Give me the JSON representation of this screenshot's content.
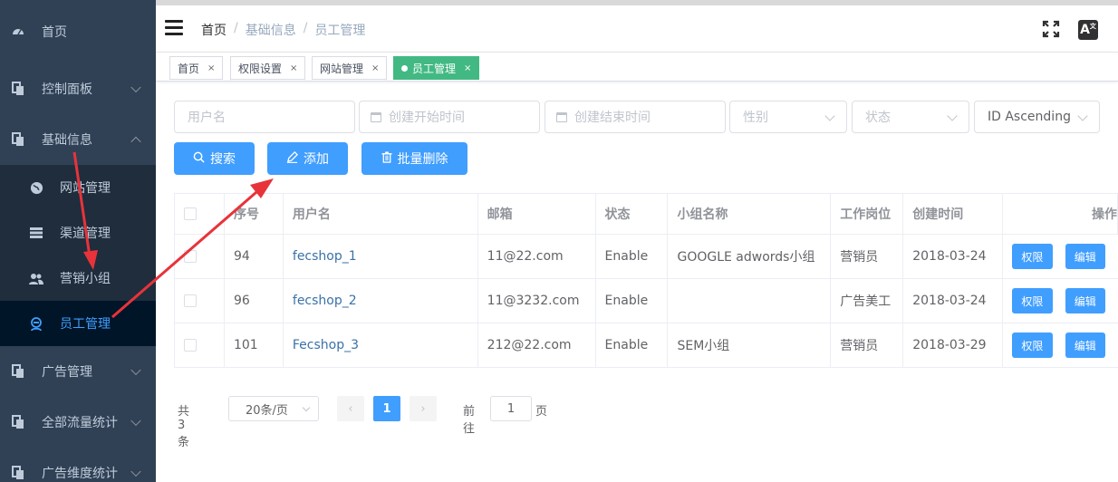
{
  "sidebar": {
    "items": [
      {
        "label": "首页",
        "icon": "dashboard-icon"
      },
      {
        "label": "控制面板",
        "icon": "copy-icon",
        "expanded": false
      },
      {
        "label": "基础信息",
        "icon": "copy-icon",
        "expanded": true
      },
      {
        "label": "广告管理",
        "icon": "copy-icon",
        "expanded": false
      },
      {
        "label": "全部流量统计",
        "icon": "copy-icon",
        "expanded": false
      },
      {
        "label": "广告维度统计",
        "icon": "copy-icon",
        "expanded": false
      }
    ],
    "submenu": [
      {
        "label": "网站管理",
        "icon": "globe-icon"
      },
      {
        "label": "渠道管理",
        "icon": "table-icon"
      },
      {
        "label": "营销小组",
        "icon": "users-icon"
      },
      {
        "label": "员工管理",
        "icon": "user-icon",
        "active": true
      }
    ]
  },
  "navbar": {
    "breadcrumb": [
      "首页",
      "基础信息",
      "员工管理"
    ],
    "separator": "/",
    "lang_label": "A",
    "lang_sup": "文"
  },
  "tags": [
    {
      "label": "首页"
    },
    {
      "label": "权限设置"
    },
    {
      "label": "网站管理"
    },
    {
      "label": "员工管理",
      "active": true
    }
  ],
  "tag_close": "×",
  "filters": {
    "username_placeholder": "用户名",
    "start_time_placeholder": "创建开始时间",
    "end_time_placeholder": "创建结束时间",
    "gender_placeholder": "性别",
    "status_placeholder": "状态",
    "sort_value": "ID Ascending"
  },
  "actions": {
    "search_label": "搜索",
    "add_label": "添加",
    "batch_delete_label": "批量删除"
  },
  "table": {
    "columns": [
      "序号",
      "用户名",
      "邮箱",
      "状态",
      "小组名称",
      "工作岗位",
      "创建时间",
      "操作"
    ],
    "rows": [
      {
        "id": "94",
        "username": "fecshop_1",
        "email": "11@22.com",
        "status": "Enable",
        "group": "GOOGLE adwords小组",
        "position": "营销员",
        "created": "2018-03-24"
      },
      {
        "id": "96",
        "username": "fecshop_2",
        "email": "11@3232.com",
        "status": "Enable",
        "group": "",
        "position": "广告美工",
        "created": "2018-03-24"
      },
      {
        "id": "101",
        "username": "Fecshop_3",
        "email": "212@22.com",
        "status": "Enable",
        "group": "SEM小组",
        "position": "营销员",
        "created": "2018-03-29"
      }
    ],
    "permission_label": "权限",
    "edit_label": "编辑"
  },
  "pagination": {
    "total": "共 3 条",
    "page_size": "20条/页",
    "prev": "‹",
    "next": "›",
    "current_page": "1",
    "goto_label": "前往",
    "goto_value": "1",
    "page_suffix": "页"
  },
  "colors": {
    "sidebar_bg": "#304156",
    "primary": "#409eff",
    "active_tag": "#42b983",
    "annotation_arrow": "#e8333a"
  }
}
